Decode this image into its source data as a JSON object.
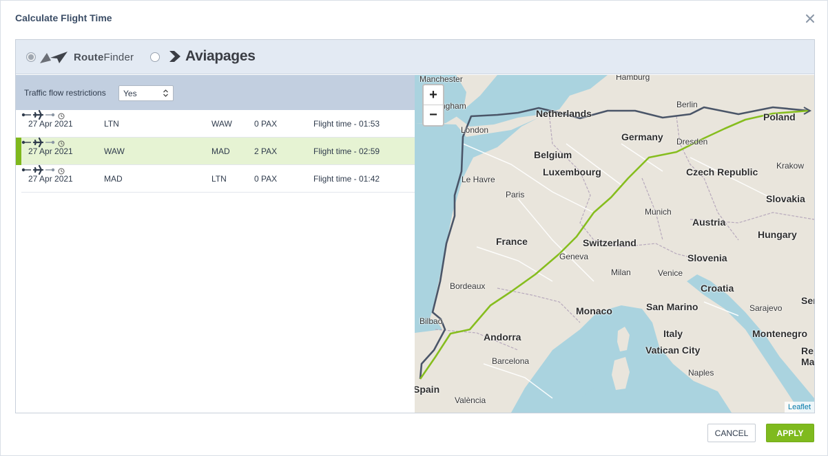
{
  "dialog": {
    "title": "Calculate Flight Time"
  },
  "providers": {
    "routefinder": {
      "name_bold": "Route",
      "name_light": "Finder",
      "selected": true
    },
    "aviapages": {
      "name": "Aviapages",
      "selected": false
    }
  },
  "traffic": {
    "label": "Traffic flow restrictions",
    "value": "Yes"
  },
  "flights": [
    {
      "date": "27 Apr 2021",
      "from": "LTN",
      "to": "WAW",
      "pax": "0 PAX",
      "flight_time": "Flight time - 01:53",
      "active": false
    },
    {
      "date": "27 Apr 2021",
      "from": "WAW",
      "to": "MAD",
      "pax": "2 PAX",
      "flight_time": "Flight time - 02:59",
      "active": true
    },
    {
      "date": "27 Apr 2021",
      "from": "MAD",
      "to": "LTN",
      "pax": "0 PAX",
      "flight_time": "Flight time - 01:42",
      "active": false
    }
  ],
  "map": {
    "labels": {
      "manchester": "Manchester",
      "birmingham": "ngham",
      "london": "London",
      "hamburg": "Hamburg",
      "netherlands": "Netherlands",
      "berlin": "Berlin",
      "poland": "Poland",
      "germany": "Germany",
      "belgium": "Belgium",
      "dresden": "Dresden",
      "krakow": "Krakow",
      "luxembourg": "Luxembourg",
      "czech": "Czech Republic",
      "lehavre": "Le Havre",
      "paris": "Paris",
      "slovakia": "Slovakia",
      "munich": "Munich",
      "austria": "Austria",
      "hungary": "Hungary",
      "france": "France",
      "switzerland": "Switzerland",
      "geneva": "Geneva",
      "slovenia": "Slovenia",
      "milan": "Milan",
      "venice": "Venice",
      "bordeaux": "Bordeaux",
      "croatia": "Croatia",
      "serbia": "Serb",
      "sanmarino": "San Marino",
      "sarajevo": "Sarajevo",
      "monaco": "Monaco",
      "bilbao": "Bilbao",
      "andorra": "Andorra",
      "italy": "Italy",
      "montenegro": "Montenegro",
      "vatican": "Vatican City",
      "barcelona": "Barcelona",
      "repmac1": "Repu",
      "repmac2": "Mace",
      "naples": "Naples",
      "spain": "Spain",
      "valencia": "València"
    },
    "zoom_in": "+",
    "zoom_out": "−",
    "attribution": "Leaflet",
    "route_colors": {
      "past": "#4a5568",
      "active": "#86bd1e"
    }
  },
  "footer": {
    "cancel": "CANCEL",
    "apply": "APPLY"
  }
}
